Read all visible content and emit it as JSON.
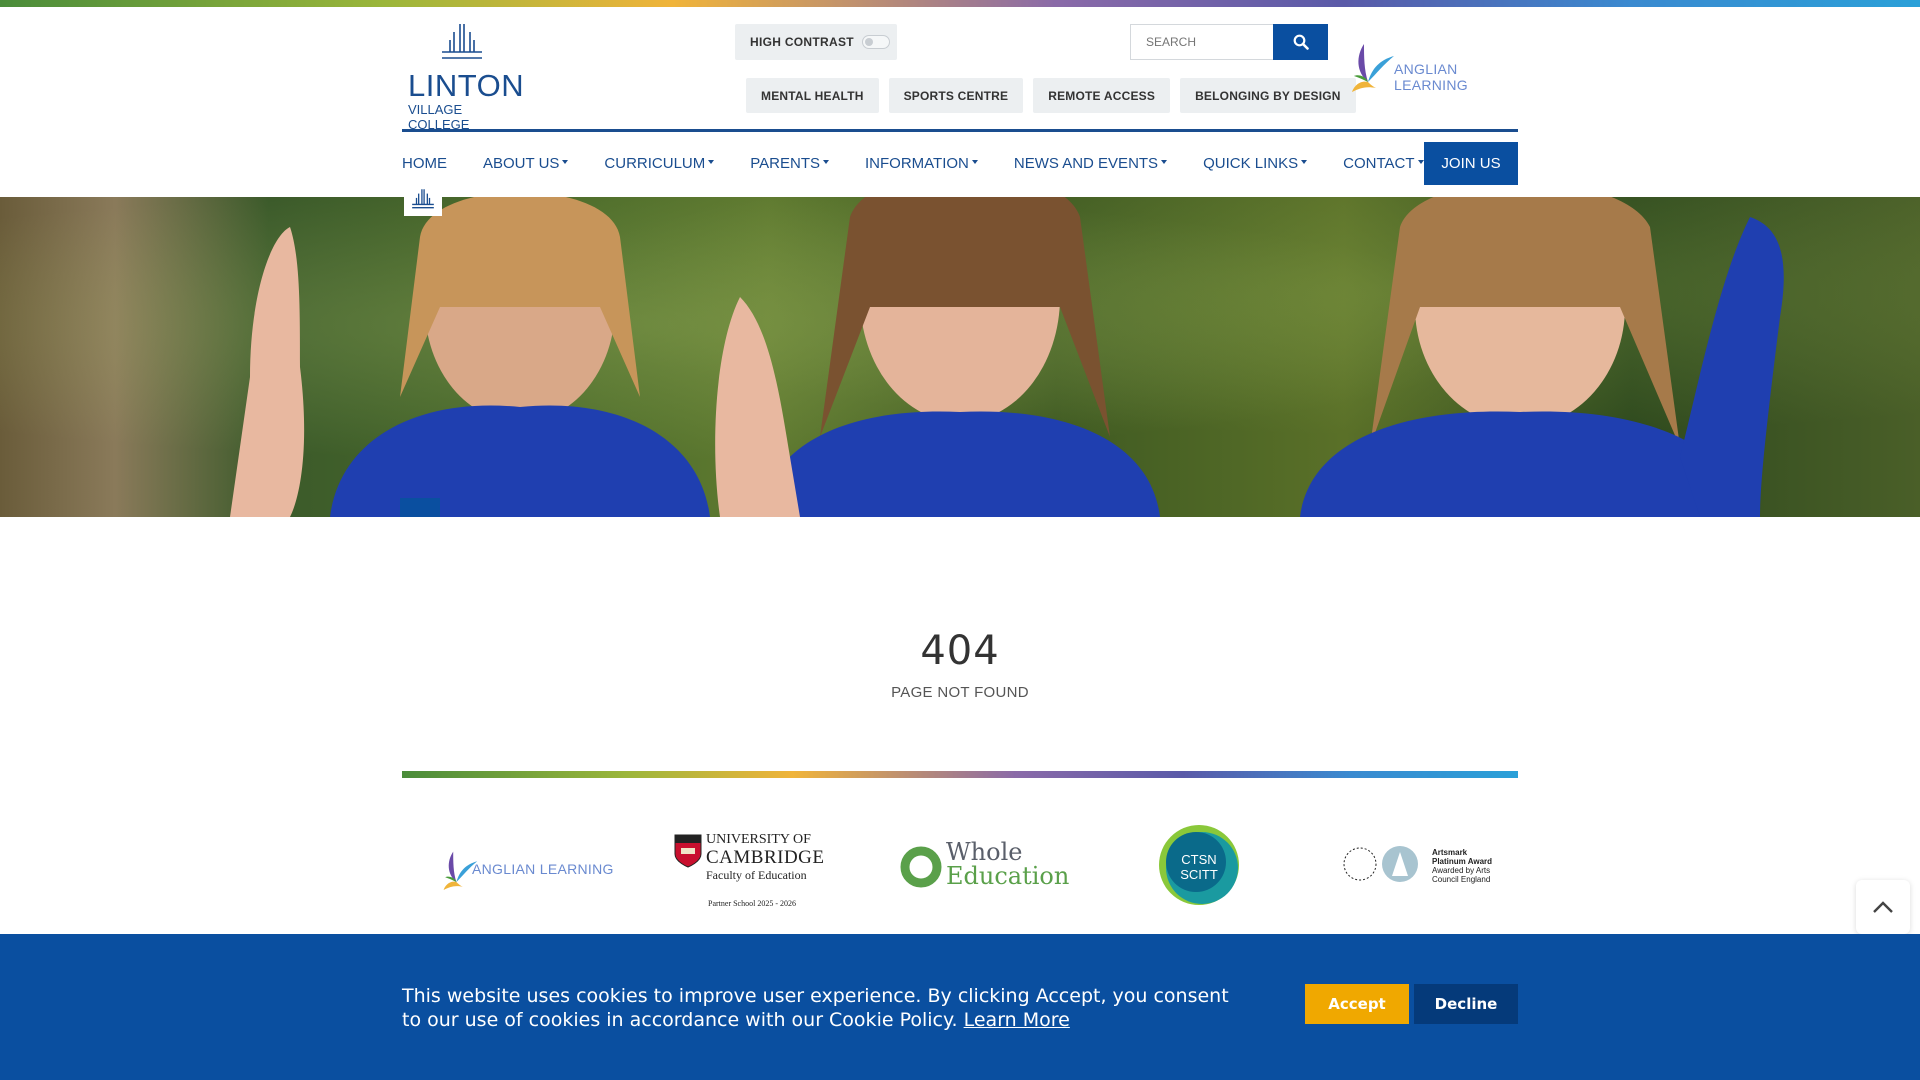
{
  "site": {
    "logo_line1": "LINTON",
    "logo_line2": "VILLAGE COLLEGE"
  },
  "header": {
    "high_contrast_label": "HIGH CONTRAST",
    "high_contrast_enabled": false,
    "search_placeholder": "SEARCH",
    "quick_links": [
      "MENTAL HEALTH",
      "SPORTS CENTRE",
      "REMOTE ACCESS",
      "BELONGING BY DESIGN"
    ],
    "partner_name": "ANGLIAN LEARNING"
  },
  "nav": {
    "items": [
      {
        "label": "HOME",
        "dropdown": false
      },
      {
        "label": "ABOUT US",
        "dropdown": true
      },
      {
        "label": "CURRICULUM",
        "dropdown": true
      },
      {
        "label": "PARENTS",
        "dropdown": true
      },
      {
        "label": "INFORMATION",
        "dropdown": true
      },
      {
        "label": "NEWS AND EVENTS",
        "dropdown": true
      },
      {
        "label": "QUICK LINKS",
        "dropdown": true
      },
      {
        "label": "CONTACT",
        "dropdown": true
      }
    ],
    "join_label": "JOIN US"
  },
  "error": {
    "code": "404",
    "message": "PAGE NOT FOUND"
  },
  "partners": {
    "anglian": "ANGLIAN LEARNING",
    "cambridge_line1": "UNIVERSITY OF",
    "cambridge_line2": "CAMBRIDGE",
    "cambridge_line3": "Faculty of Education",
    "cambridge_line4": "Partner School 2025 - 2026",
    "whole_line1": "Whole",
    "whole_line2": "Education",
    "ctsn_line1": "CTSN",
    "ctsn_line2": "SCITT",
    "arts_line1": "Artsmark",
    "arts_line2": "Platinum Award",
    "arts_line3": "Awarded by Arts",
    "arts_line4": "Council England"
  },
  "cookie": {
    "text": "This website uses cookies to improve user experience. By clicking Accept, you consent to our use of cookies in accordance with our Cookie Policy.",
    "link": "Learn More",
    "accept": "Accept",
    "decline": "Decline"
  },
  "colors": {
    "brand_blue": "#0a4fa0",
    "nav_text": "#1a4d8f",
    "accept": "#f0a800"
  }
}
